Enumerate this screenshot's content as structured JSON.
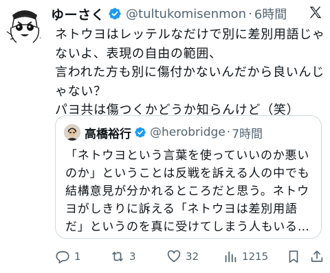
{
  "tweet": {
    "author_name": "ゆーさく",
    "handle": "@tultukomisenmon",
    "time": "6時間",
    "lines": [
      "ネトウヨはレッテルなだけで別に差別用語じゃ",
      "ないよ、表現の自由の範囲、",
      "言われた方も別に傷付かないんだから良いんじ",
      "ゃない？",
      "パヨ共は傷つくかどうか知らんけど（笑）"
    ]
  },
  "quote": {
    "author_name": "高橋裕行",
    "handle": "@herobridge",
    "time": "7時間",
    "lines": [
      "「ネトウヨという言葉を使っていいのか悪い",
      "のか」ということは反戦を訴える人の中でも",
      "結構意見が分かれるところだと思う。ネトウ",
      "ヨがしきりに訴える「ネトウヨは差別用語",
      "だ」というのを真に受けてしまう人もいる…"
    ]
  },
  "actions": {
    "replies": "1",
    "retweets": "3",
    "likes": "32",
    "views": "1215"
  },
  "colors": {
    "verified": "#1d9bf0",
    "secondary_text": "#536471",
    "border": "#cfd9de"
  },
  "icons": [
    "avatar-cartoon",
    "verified-badge-icon",
    "x-logo-icon",
    "reply-icon",
    "retweet-icon",
    "like-icon",
    "views-icon",
    "bookmark-icon",
    "share-icon"
  ]
}
